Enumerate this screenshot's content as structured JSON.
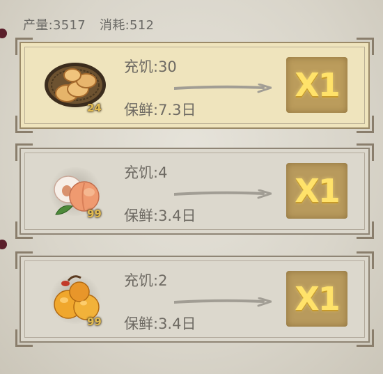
{
  "header": {
    "production": "产量:3517",
    "consumption": "消耗:512"
  },
  "items": [
    {
      "food_icon": "flatbread-basket-icon",
      "count": "24",
      "hunger": "充饥:30",
      "freshness": "保鲜:7.3日",
      "multiplier": "X1",
      "selected": true
    },
    {
      "food_icon": "peach-icon",
      "count": "99",
      "hunger": "充饥:4",
      "freshness": "保鲜:3.4日",
      "multiplier": "X1",
      "selected": false
    },
    {
      "food_icon": "loquat-icon",
      "count": "99",
      "hunger": "充饥:2",
      "freshness": "保鲜:3.4日",
      "multiplier": "X1",
      "selected": false
    }
  ],
  "colors": {
    "selected_card_bg": "#efe4bd",
    "card_bg": "#dcd8cd",
    "button_bg": "#b89a5d",
    "button_text": "#ffe26a",
    "count_text": "#e0ba50"
  }
}
